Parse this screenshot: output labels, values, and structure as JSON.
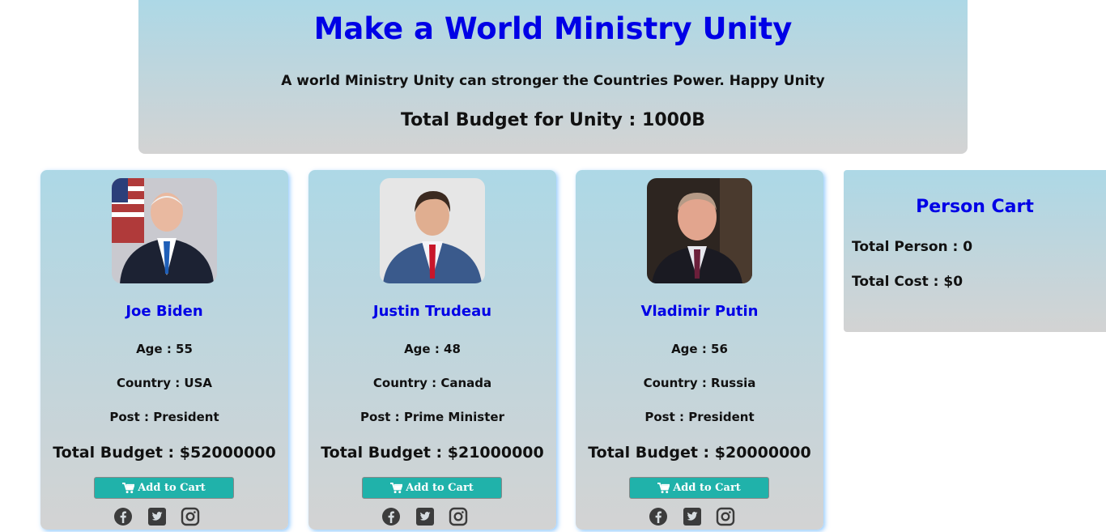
{
  "header": {
    "title": "Make a World Ministry Unity",
    "subtitle": "A world Ministry Unity can stronger the Countries Power. Happy Unity",
    "budget": "Total Budget for Unity : 1000B"
  },
  "persons": [
    {
      "name": "Joe Biden",
      "age": "Age : 55",
      "country": "Country : USA",
      "post": "Post : President",
      "budget": "Total Budget : $52000000",
      "button": "Add to Cart",
      "photo_desc": "man-in-suit-blue-tie-with-flags"
    },
    {
      "name": "Justin Trudeau",
      "age": "Age : 48",
      "country": "Country : Canada",
      "post": "Post : Prime Minister",
      "budget": "Total Budget : $21000000",
      "button": "Add to Cart",
      "photo_desc": "man-in-blue-suit-red-tie"
    },
    {
      "name": "Vladimir Putin",
      "age": "Age : 56",
      "country": "Country : Russia",
      "post": "Post : President",
      "budget": "Total Budget : $20000000",
      "button": "Add to Cart",
      "photo_desc": "man-in-dark-suit-maroon-tie"
    }
  ],
  "cart": {
    "title": "Person Cart",
    "total_person": "Total Person : 0",
    "total_cost": "Total Cost : $0"
  },
  "social_icons": [
    "facebook-icon",
    "twitter-icon",
    "instagram-icon"
  ],
  "colors": {
    "accent": "#0000e6",
    "button": "#20b2aa",
    "gradient_top": "#add8e6",
    "gradient_bottom": "#d3d3d3"
  }
}
